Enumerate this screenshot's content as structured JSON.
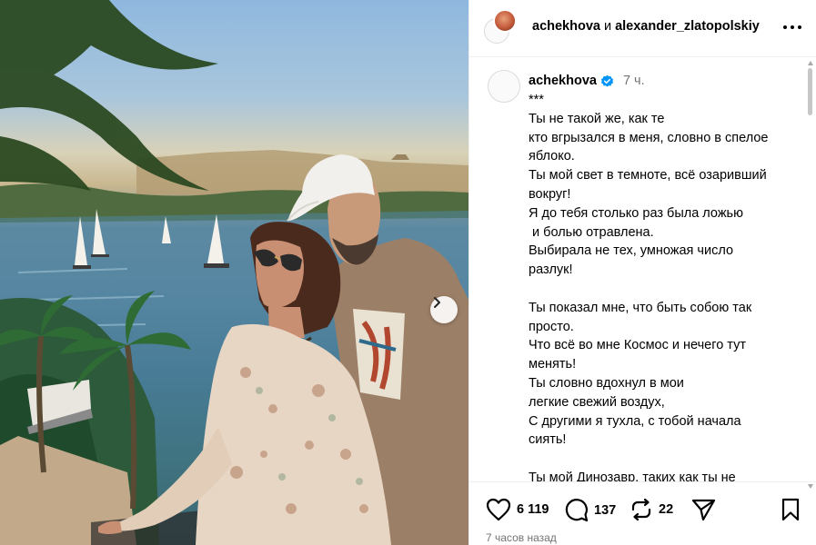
{
  "header": {
    "user_a": "achekhova",
    "conjunction": "и",
    "user_b": "alexander_zlatopolskiy"
  },
  "caption": {
    "username": "achekhova",
    "time": "7 ч.",
    "lines": [
      "***",
      "Ты не такой же, как те",
      "кто вгрызался в меня, словно в спелое",
      "яблоко.",
      "Ты мой свет в темноте, всё озаривший",
      "вокруг!",
      "Я до тебя столько раз была ложью",
      " и болью отравлена.",
      "Выбирала не тех, умножая число",
      "разлук!",
      "",
      "Ты показал мне, что быть собою так",
      "просто.",
      "Что всё во мне Космос и нечего тут",
      "менять!",
      "Ты словно вдохнул в мои",
      "легкие свежий воздух,",
      "С другими я тухла, с тобой начала",
      "сиять!",
      "",
      "Ты мой Динозавр, таких как ты не"
    ]
  },
  "actions": {
    "likes": "6 119",
    "comments": "137",
    "reposts": "22",
    "timeago": "7 часов назад"
  },
  "colors": {
    "verified": "#0095f6",
    "muted": "#737373",
    "divider": "#efefef"
  },
  "icons": [
    "more-icon",
    "verified-icon",
    "chevron-right-icon",
    "heart-icon",
    "comment-icon",
    "repost-icon",
    "share-icon",
    "bookmark-icon"
  ]
}
